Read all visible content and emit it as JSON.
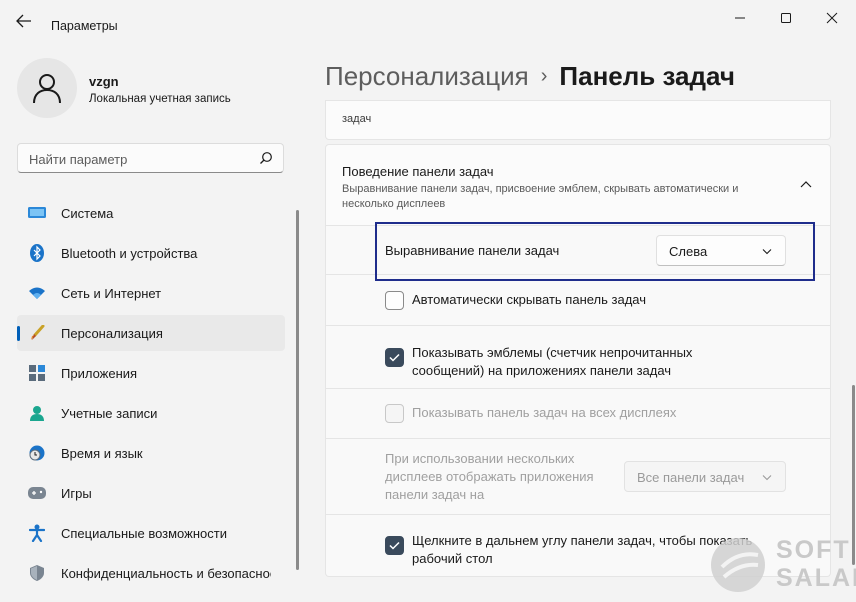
{
  "window": {
    "title": "Параметры",
    "controls": {
      "minimize": "minimize-icon",
      "maximize": "maximize-icon",
      "close": "close-icon"
    }
  },
  "user": {
    "name": "vzgn",
    "account_type": "Локальная учетная запись"
  },
  "search": {
    "placeholder": "Найти параметр"
  },
  "sidebar": {
    "items": [
      {
        "label": "Система",
        "icon": "monitor-icon"
      },
      {
        "label": "Bluetooth и устройства",
        "icon": "bluetooth-icon"
      },
      {
        "label": "Сеть и Интернет",
        "icon": "wifi-icon"
      },
      {
        "label": "Персонализация",
        "icon": "brush-icon",
        "active": true
      },
      {
        "label": "Приложения",
        "icon": "apps-icon"
      },
      {
        "label": "Учетные записи",
        "icon": "person-icon"
      },
      {
        "label": "Время и язык",
        "icon": "clock-globe-icon"
      },
      {
        "label": "Игры",
        "icon": "gamepad-icon"
      },
      {
        "label": "Специальные возможности",
        "icon": "accessibility-icon"
      },
      {
        "label": "Конфиденциальность и безопасность",
        "icon": "shield-icon"
      }
    ]
  },
  "breadcrumb": {
    "parent": "Персонализация",
    "separator": "›",
    "current": "Панель задач"
  },
  "content": {
    "top_card_text": "задач",
    "section": {
      "title": "Поведение панели задач",
      "description": "Выравнивание панели задач, присвоение эмблем, скрывать автоматически и несколько дисплеев"
    },
    "alignment": {
      "label": "Выравнивание панели задач",
      "value": "Слева"
    },
    "auto_hide": {
      "label": "Автоматически скрывать панель задач",
      "checked": false
    },
    "badges": {
      "label": "Показывать эмблемы (счетчик непрочитанных сообщений) на приложениях панели задач",
      "checked": true
    },
    "all_displays": {
      "label": "Показывать панель задач на всех дисплеях",
      "checked": false,
      "disabled": true
    },
    "multi_display": {
      "label": "При использовании нескольких дисплеев отображать приложения панели задач на",
      "value": "Все панели задач",
      "disabled": true
    },
    "show_desktop": {
      "label": "Щелкните в дальнем углу панели задач, чтобы показать рабочий стол",
      "checked": true
    }
  },
  "colors": {
    "accent": "#005fb8",
    "highlight_box": "#1f2d8c",
    "checkbox_checked": "#3a4a5c"
  },
  "watermark": {
    "line1": "SOFT",
    "line2": "SALAD"
  }
}
